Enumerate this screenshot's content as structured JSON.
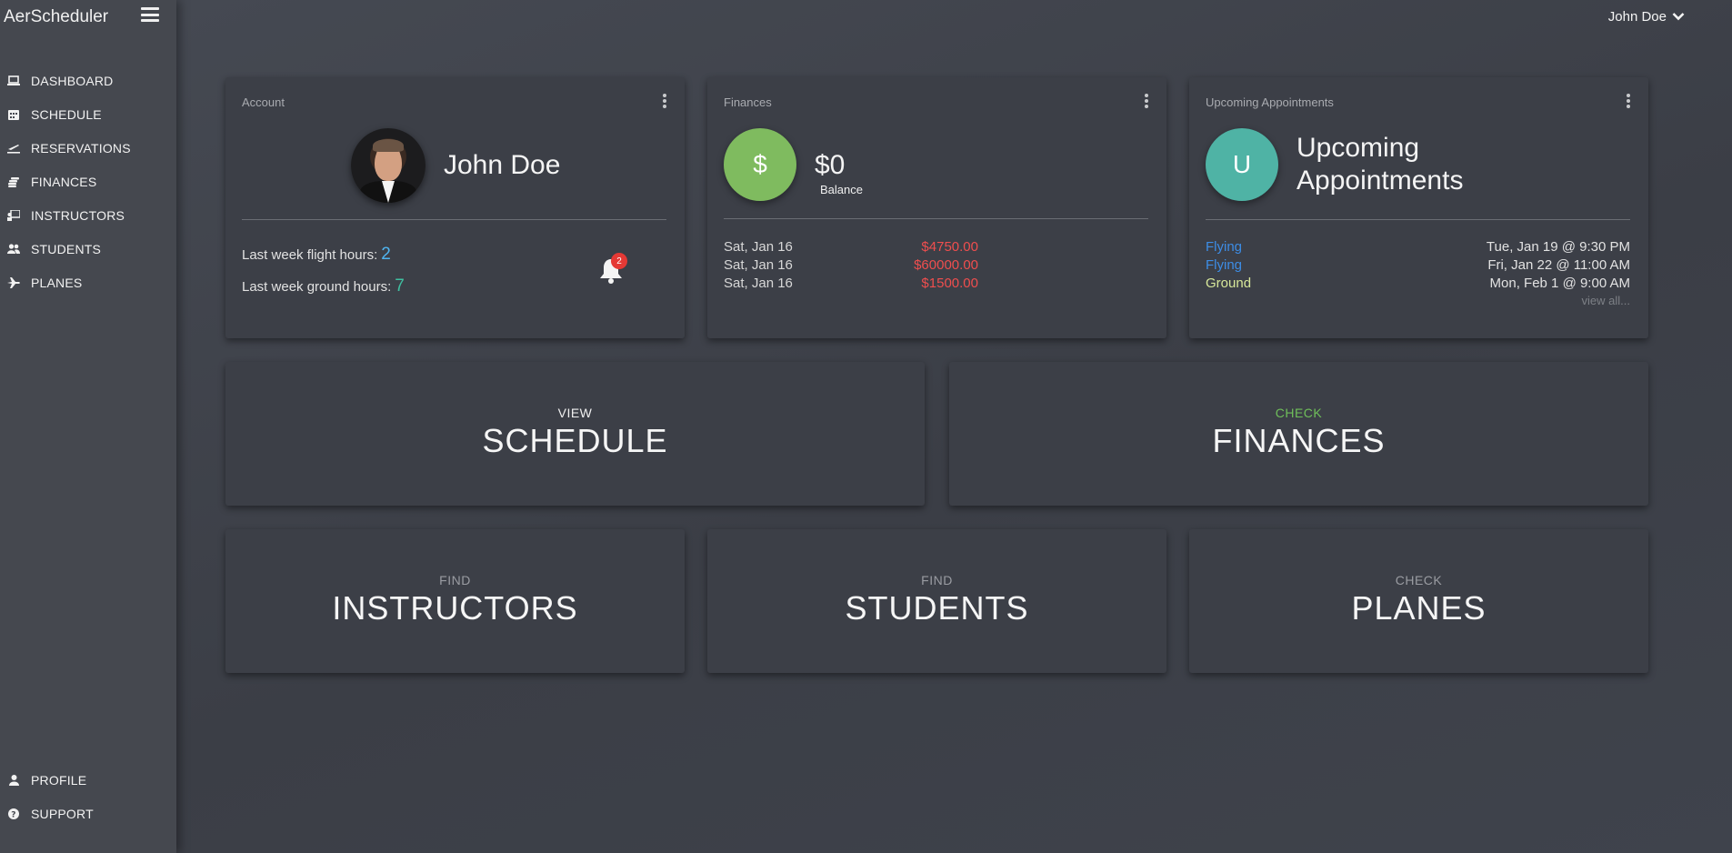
{
  "app": {
    "title": "AerScheduler"
  },
  "sidebar": {
    "items": [
      {
        "label": "DASHBOARD",
        "icon": "laptop-icon"
      },
      {
        "label": "SCHEDULE",
        "icon": "calendar-icon"
      },
      {
        "label": "RESERVATIONS",
        "icon": "plane-departure-icon"
      },
      {
        "label": "FINANCES",
        "icon": "coins-icon"
      },
      {
        "label": "INSTRUCTORS",
        "icon": "chalkboard-teacher-icon"
      },
      {
        "label": "STUDENTS",
        "icon": "users-icon"
      },
      {
        "label": "PLANES",
        "icon": "plane-icon"
      }
    ],
    "bottom_items": [
      {
        "label": "PROFILE",
        "icon": "user-icon"
      },
      {
        "label": "SUPPORT",
        "icon": "question-circle-icon"
      }
    ]
  },
  "header": {
    "user_name": "John Doe"
  },
  "account": {
    "title": "Account",
    "name": "John Doe",
    "flight_label": "Last week flight hours:",
    "flight_value": "2",
    "ground_label": "Last week ground hours:",
    "ground_value": "7",
    "notifications": "2"
  },
  "finances": {
    "title": "Finances",
    "icon_text": "$",
    "balance": "$0",
    "balance_label": "Balance",
    "icon_color": "#7fbb5f",
    "rows": [
      {
        "date": "Sat, Jan 16",
        "amount": "$4750.00"
      },
      {
        "date": "Sat, Jan 16",
        "amount": "$60000.00"
      },
      {
        "date": "Sat, Jan 16",
        "amount": "$1500.00"
      }
    ]
  },
  "appointments": {
    "title": "Upcoming Appointments",
    "icon_text": "U",
    "heading_line1": "Upcoming",
    "heading_line2": "Appointments",
    "icon_color": "#4fb3a5",
    "rows": [
      {
        "type": "Flying",
        "when": "Tue, Jan 19 @ 9:30 PM",
        "color": "#3d8de6"
      },
      {
        "type": "Flying",
        "when": "Fri, Jan 22 @ 11:00 AM",
        "color": "#3d8de6"
      },
      {
        "type": "Ground",
        "when": "Mon, Feb 1 @ 9:00 AM",
        "color": "#d7e79a"
      }
    ],
    "view_all": "view all..."
  },
  "tiles": {
    "schedule": {
      "pre": "VIEW",
      "big": "SCHEDULE",
      "pre_color": "#f0f0f0"
    },
    "finances": {
      "pre": "CHECK",
      "big": "FINANCES",
      "pre_color": "#6fbf5a"
    },
    "instructors": {
      "pre": "FIND",
      "big": "INSTRUCTORS",
      "pre_color": "#9a9ca2"
    },
    "students": {
      "pre": "FIND",
      "big": "STUDENTS",
      "pre_color": "#9a9ca2"
    },
    "planes": {
      "pre": "CHECK",
      "big": "PLANES",
      "pre_color": "#9a9ca2"
    }
  }
}
